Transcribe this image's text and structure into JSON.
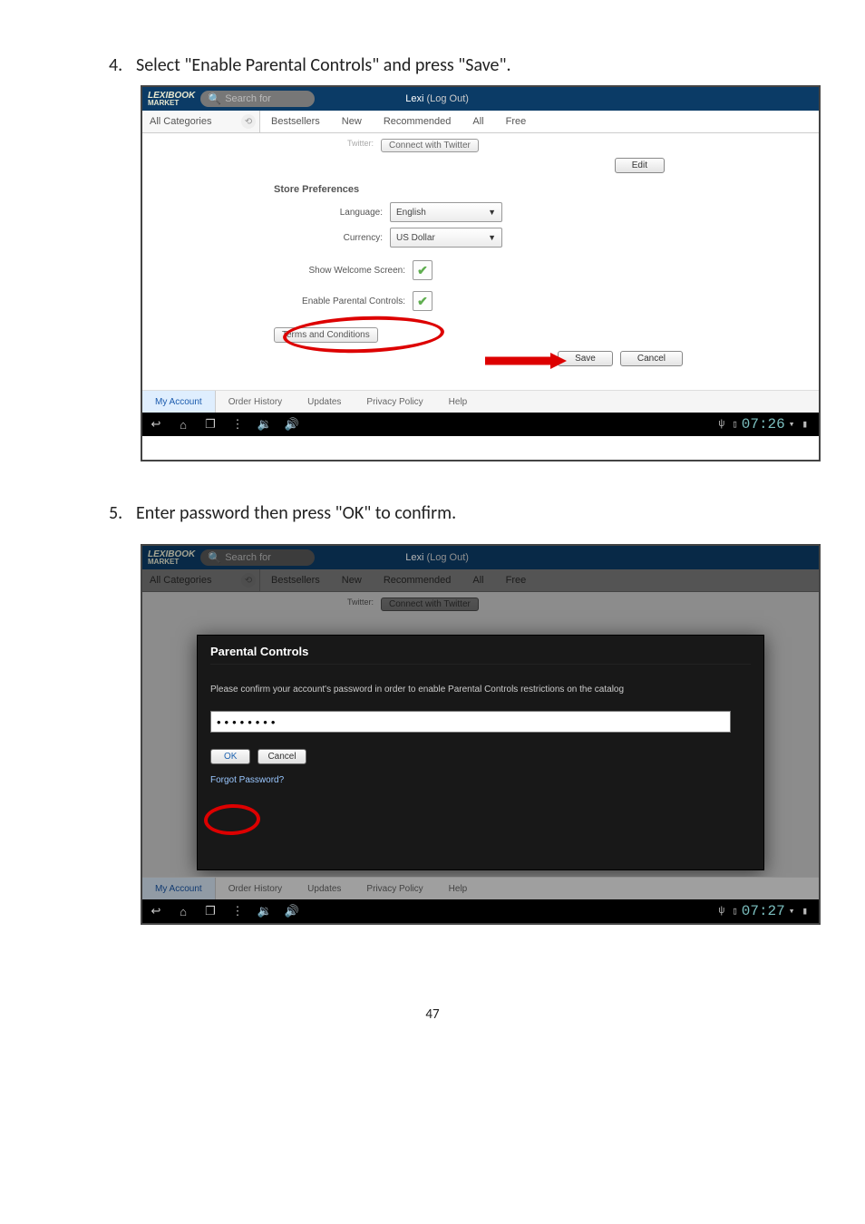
{
  "steps": {
    "s4": {
      "num": "4.",
      "text": "Select \"Enable Parental Controls\" and press \"Save\"."
    },
    "s5": {
      "num": "5.",
      "text": "Enter password then press \"OK\" to confirm."
    }
  },
  "header": {
    "logo_top": "LEXIBOOK",
    "logo_sub": "MARKET",
    "search_placeholder": "Search for",
    "user": "Lexi",
    "logout": "(Log Out)"
  },
  "catbar": {
    "all": "All Categories",
    "tabs": [
      "Bestsellers",
      "New",
      "Recommended",
      "All",
      "Free"
    ]
  },
  "twitter": {
    "label": "Twitter:",
    "button": "Connect with Twitter"
  },
  "edit_btn": "Edit",
  "prefs": {
    "title": "Store Preferences",
    "language_label": "Language:",
    "language_value": "English",
    "currency_label": "Currency:",
    "currency_value": "US Dollar",
    "welcome_label": "Show Welcome Screen:",
    "parental_label": "Enable Parental Controls:",
    "terms": "Terms and Conditions",
    "save": "Save",
    "cancel": "Cancel"
  },
  "bottom_tabs": [
    "My Account",
    "Order History",
    "Updates",
    "Privacy Policy",
    "Help"
  ],
  "clock1": "07:26",
  "clock2": "07:27",
  "modal": {
    "title": "Parental Controls",
    "text": "Please confirm your account's password in order to enable Parental Controls restrictions on the catalog",
    "pw_mask": "••••••••",
    "ok": "OK",
    "cancel": "Cancel",
    "forgot": "Forgot Password?"
  },
  "page_number": "47"
}
